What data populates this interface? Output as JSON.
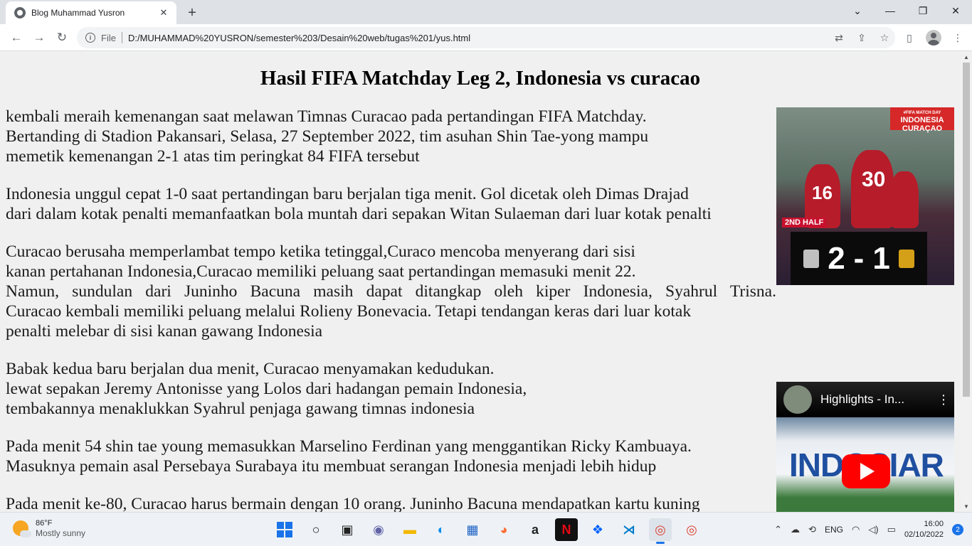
{
  "browser": {
    "tab_title": "Blog Muhammad Yusron",
    "tab_close": "✕",
    "new_tab": "+",
    "window_controls": {
      "minimize": "—",
      "restore": "❐",
      "close": "✕",
      "dropdown": "⌄"
    },
    "scheme_label": "File",
    "url": "D:/MUHAMMAD%20YUSRON/semester%203/Desain%20web/tugas%201/yus.html",
    "nav": {
      "back": "←",
      "forward": "→",
      "reload": "↻"
    },
    "icons": [
      "translate-icon",
      "share-icon",
      "bookmark-star-icon",
      "side-panel-icon",
      "profile-avatar",
      "menu-icon"
    ]
  },
  "page": {
    "title": "Hasil FIFA Matchday Leg 2, Indonesia vs curacao",
    "paragraphs": [
      "kembali meraih kemenangan saat melawan Timnas Curacao pada pertandingan FIFA Matchday.\nBertanding di Stadion Pakansari, Selasa, 27 September 2022, tim asuhan Shin Tae-yong mampu\nmemetik kemenangan 2-1 atas tim peringkat 84 FIFA tersebut",
      "Indonesia unggul cepat 1-0 saat pertandingan baru berjalan tiga menit. Gol dicetak oleh Dimas Drajad\ndari dalam kotak penalti memanfaatkan bola muntah dari sepakan Witan Sulaeman dari luar kotak penalti",
      "Curacao berusaha memperlambat tempo ketika tetinggal,Curaco mencoba menyerang dari sisi\nkanan pertahanan Indonesia,Curacao memiliki peluang saat pertandingan memasuki menit 22.",
      "Babak kedua baru berjalan dua menit, Curacao menyamakan kedudukan.\nlewat sepakan Jeremy Antonisse yang Lolos dari hadangan pemain Indonesia,\ntembakannya menaklukkan Syahrul penjaga gawang timnas indonesia",
      "Pada menit 54 shin tae young memasukkan Marselino Ferdinan yang menggantikan Ricky Kambuaya.\nMasuknya pemain asal Persebaya Surabaya itu membuat serangan Indonesia menjadi lebih hidup",
      "Pada menit ke-80, Curacao harus bermain dengan 10 orang. Juninho Bacuna mendapatkan kartu kuning"
    ],
    "paragraph3_justify": "Namun, sundulan dari Juninho Bacuna masih dapat ditangkap oleh kiper Indonesia, Syahrul Trisna.",
    "paragraph3_tail": "Curacao kembali memiliki peluang melalui Rolieny Bonevacia. Tetapi tendangan keras dari luar kotak\npenalti melebar di sisi kanan gawang Indonesia",
    "photo": {
      "badge_top": "#FIFA MATCH DAY",
      "badge_line1": "INDONESIA",
      "badge_line2": "CURAÇAO",
      "half_tag": "2ND HALF",
      "score_home": "2",
      "score_sep": "-",
      "score_away": "1",
      "jersey_a": "16",
      "jersey_b": "30"
    },
    "video": {
      "title": "Highlights - In...",
      "more": "⋮",
      "banner": "INDOSIAR"
    }
  },
  "taskbar": {
    "weather_temp": "86°F",
    "weather_desc": "Mostly sunny",
    "language": "ENG",
    "time": "16:00",
    "date": "02/10/2022",
    "notifications": "2"
  }
}
